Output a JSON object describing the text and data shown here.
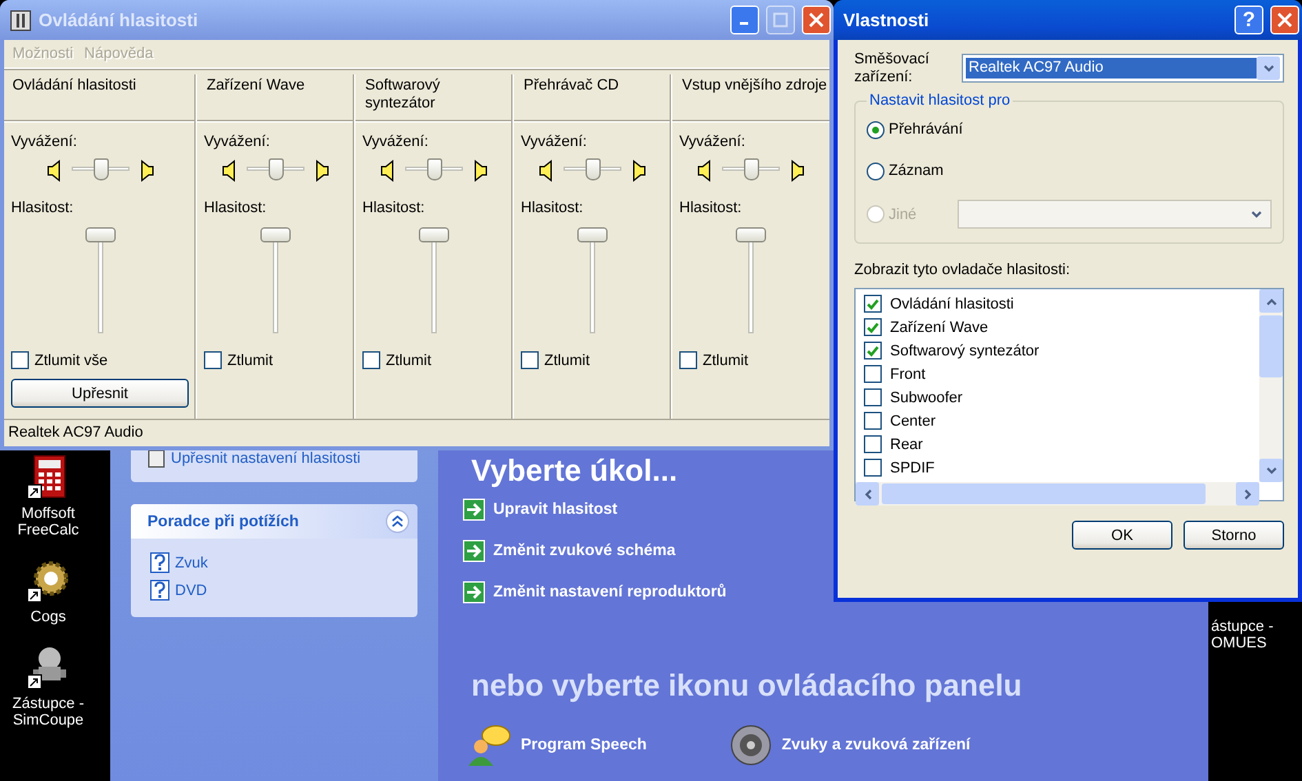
{
  "desktop_icons": [
    {
      "label": "Moffsoft FreeCalc",
      "kind": "calc"
    },
    {
      "label": "Cogs",
      "kind": "cogs"
    },
    {
      "label": "Zástupce - SimCoupe",
      "kind": "robot"
    }
  ],
  "partial_icons": [
    {
      "lines": [
        "ástupce -",
        "OMUES"
      ]
    }
  ],
  "control_panel": {
    "cards": [
      {
        "kind": "links",
        "links": [
          "Upřesnit nastavení hlasitosti"
        ]
      },
      {
        "kind": "help",
        "title": "Poradce při potížích",
        "expanded": true,
        "links": [
          "Zvuk",
          "DVD"
        ]
      }
    ],
    "heading": "Vyberte úkol...",
    "tasks": [
      "Upravit hlasitost",
      "Změnit zvukové schéma",
      "Změnit nastavení reproduktorů"
    ],
    "section_title": "nebo vyberte ikonu ovládacího panelu",
    "icons": [
      {
        "label": "Program Speech",
        "kind": "speech"
      },
      {
        "label": "Zvuky a zvuková zařízení",
        "kind": "speaker"
      }
    ]
  },
  "mixer": {
    "title": "Ovládání hlasitosti",
    "active": false,
    "menu": [
      {
        "label": "Možnosti",
        "disabled": true
      },
      {
        "label": "Nápověda",
        "disabled": true
      }
    ],
    "channels": [
      {
        "name": "Ovládání hlasitosti",
        "balance_label": "Vyvážení:",
        "balance": {
          "level": 0.5
        },
        "volume_label": "Hlasitost:",
        "volume": {
          "level": 1
        },
        "mute_label": "Ztlumit vše",
        "muted": false,
        "button": "Upřesnit"
      },
      {
        "name": "Zařízení Wave",
        "balance_label": "Vyvážení:",
        "balance": {
          "level": 0.5
        },
        "volume_label": "Hlasitost:",
        "volume": {
          "level": 1
        },
        "mute_label": "Ztlumit",
        "muted": false
      },
      {
        "name": "Softwarový syntezátor",
        "balance_label": "Vyvážení:",
        "balance": {
          "level": 0.5
        },
        "volume_label": "Hlasitost:",
        "volume": {
          "level": 1
        },
        "mute_label": "Ztlumit",
        "muted": false
      },
      {
        "name": "Přehrávač CD",
        "balance_label": "Vyvážení:",
        "balance": {
          "level": 0.5
        },
        "volume_label": "Hlasitost:",
        "volume": {
          "level": 1
        },
        "mute_label": "Ztlumit",
        "muted": false
      },
      {
        "name": "Vstup vnějšího zdroje",
        "balance_label": "Vyvážení:",
        "balance": {
          "level": 0.5
        },
        "volume_label": "Hlasitost:",
        "volume": {
          "level": 1
        },
        "mute_label": "Ztlumit",
        "muted": false
      }
    ],
    "status_bar": "Realtek AC97 Audio"
  },
  "properties": {
    "title": "Vlastnosti",
    "active": true,
    "help_button": "?",
    "device_label": "Směšovací zařízení:",
    "device_value": "Realtek AC97 Audio",
    "group_title": "Nastavit hlasitost pro",
    "options": [
      {
        "label": "Přehrávání",
        "selected": true,
        "disabled": false,
        "kind": "plain"
      },
      {
        "label": "Záznam",
        "selected": false,
        "disabled": false,
        "kind": "plain"
      },
      {
        "label": "Jiné",
        "selected": false,
        "disabled": true,
        "kind": "with_select"
      }
    ],
    "controls_label": "Zobrazit tyto ovladače hlasitosti:",
    "controls": [
      {
        "label": "Ovládání hlasitosti",
        "checked": true
      },
      {
        "label": "Zařízení Wave",
        "checked": true
      },
      {
        "label": "Softwarový syntezátor",
        "checked": true
      },
      {
        "label": "Front",
        "checked": false
      },
      {
        "label": "Subwoofer",
        "checked": false
      },
      {
        "label": "Center",
        "checked": false
      },
      {
        "label": "Rear",
        "checked": false
      },
      {
        "label": "SPDIF",
        "checked": false
      }
    ],
    "buttons": [
      "OK",
      "Storno"
    ]
  }
}
